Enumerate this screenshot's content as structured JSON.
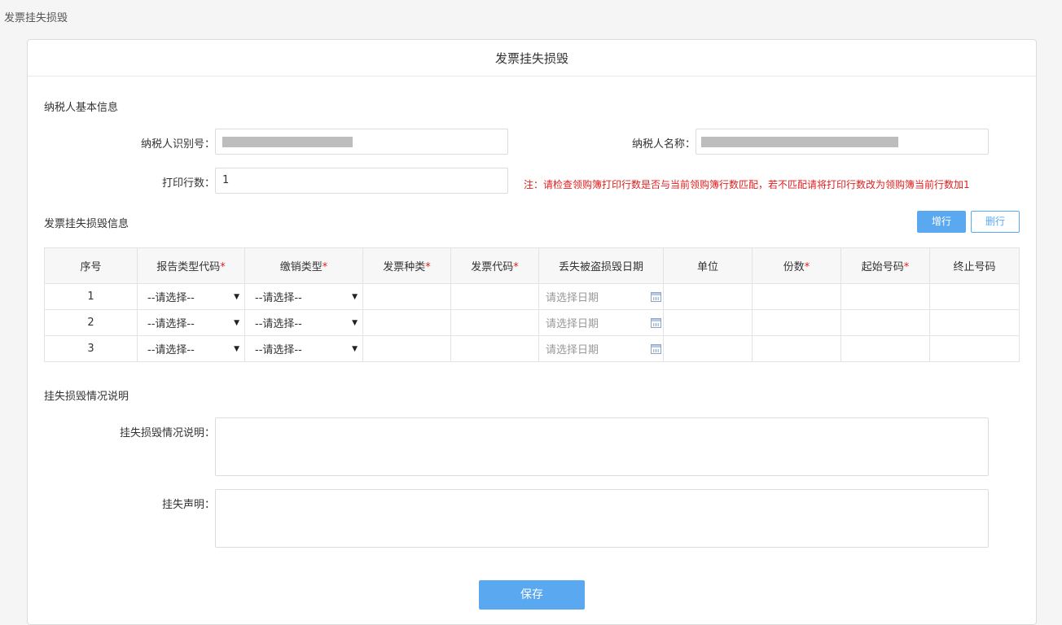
{
  "breadcrumb": "发票挂失损毁",
  "panel_title": "发票挂失损毁",
  "basic_section": {
    "title": "纳税人基本信息",
    "taxpayer_id_label": "纳税人识别号：",
    "taxpayer_name_label": "纳税人名称：",
    "print_rows_label": "打印行数：",
    "print_rows_value": "1",
    "note": "注：请检查领购簿打印行数是否与当前领购簿行数匹配，若不匹配请将打印行数改为领购簿当前行数加1"
  },
  "invoice_section": {
    "title": "发票挂失损毁信息",
    "add_row_label": "增行",
    "delete_row_label": "删行",
    "columns": [
      {
        "label": "序号",
        "required": ""
      },
      {
        "label": "报告类型代码",
        "required": "*"
      },
      {
        "label": "缴销类型",
        "required": "*"
      },
      {
        "label": "发票种类",
        "required": "*"
      },
      {
        "label": "发票代码",
        "required": "*"
      },
      {
        "label": "丢失被盗损毁日期",
        "required": ""
      },
      {
        "label": "单位",
        "required": ""
      },
      {
        "label": "份数",
        "required": "*"
      },
      {
        "label": "起始号码",
        "required": "*"
      },
      {
        "label": "终止号码",
        "required": ""
      }
    ],
    "rows": [
      {
        "seq": "1",
        "report_type": "--请选择--",
        "cancel_type": "--请选择--",
        "date_placeholder": "请选择日期"
      },
      {
        "seq": "2",
        "report_type": "--请选择--",
        "cancel_type": "--请选择--",
        "date_placeholder": "请选择日期"
      },
      {
        "seq": "3",
        "report_type": "--请选择--",
        "cancel_type": "--请选择--",
        "date_placeholder": "请选择日期"
      }
    ]
  },
  "desc_section": {
    "title": "挂失损毁情况说明",
    "desc_label": "挂失损毁情况说明：",
    "statement_label": "挂失声明："
  },
  "save_label": "保存",
  "colors": {
    "accent": "#5aa9f0",
    "warning": "#e02020"
  }
}
